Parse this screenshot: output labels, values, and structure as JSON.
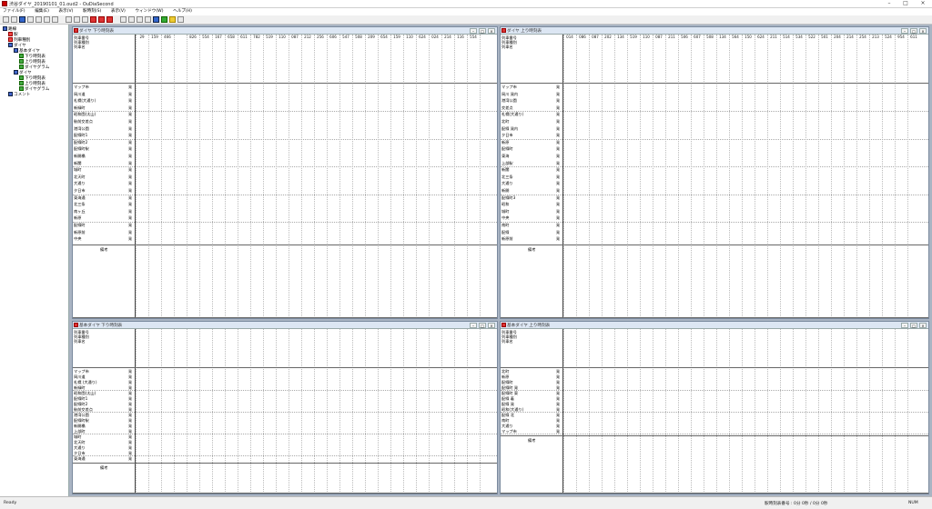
{
  "app": {
    "title": "渋谷ダイヤ_20190101_01.oud2 - OuDiaSecond"
  },
  "menu": [
    "ファイル(F)",
    "編集(E)",
    "表示(V)",
    "駅時刻(S)",
    "表示(V)",
    "ウィンドウ(W)",
    "ヘルプ(H)"
  ],
  "toolbar": {
    "buttons": [
      "new-icon",
      "open-icon",
      "save-icon",
      "print-icon",
      "undo-icon",
      "redo-icon",
      "cut-icon",
      "copy-icon",
      "paste-icon",
      "delete-icon",
      "window-icon",
      "cascade-icon",
      "tile-icon",
      "up-icon",
      "down-icon",
      "left-icon",
      "right-icon",
      "station-icon",
      "train-icon",
      "diagram-icon",
      "help-icon"
    ]
  },
  "tree": {
    "items": [
      {
        "label": "路線",
        "level": 0,
        "icon": "route-icon"
      },
      {
        "label": "駅",
        "level": 1,
        "icon": "station-icon"
      },
      {
        "label": "列車種別",
        "level": 1,
        "icon": "train-type-icon"
      },
      {
        "label": "ダイヤ",
        "level": 1,
        "icon": "dia-icon"
      },
      {
        "label": "基本ダイヤ",
        "level": 2,
        "icon": "dia-icon"
      },
      {
        "label": "下り時刻表",
        "level": 3,
        "icon": "timetable-icon"
      },
      {
        "label": "上り時刻表",
        "level": 3,
        "icon": "timetable-icon"
      },
      {
        "label": "ダイヤグラム",
        "level": 3,
        "icon": "diagram-icon"
      },
      {
        "label": "ダイヤ",
        "level": 2,
        "icon": "dia-icon"
      },
      {
        "label": "下り時刻表",
        "level": 3,
        "icon": "timetable-icon"
      },
      {
        "label": "上り時刻表",
        "level": 3,
        "icon": "timetable-icon"
      },
      {
        "label": "ダイヤグラム",
        "level": 3,
        "icon": "diagram-icon"
      },
      {
        "label": "コメント",
        "level": 1,
        "icon": "comment-icon"
      }
    ]
  },
  "windows": [
    {
      "title": "ダイヤ 下り時刻表",
      "row_labels": [
        "列車番号",
        "列車種別",
        "列車名"
      ],
      "remarks_label": "備考",
      "columns": [
        "29",
        "159",
        "466",
        "",
        "826",
        "554",
        "167",
        "658",
        "611",
        "782",
        "519",
        "110",
        "087",
        "212",
        "256",
        "606",
        "547",
        "508",
        "209",
        "654",
        "159",
        "110",
        "624",
        "024",
        "214",
        "116",
        "554"
      ],
      "stations": [
        "マップ市",
        "岡川道",
        "札幌(大通り)",
        "新緑町",
        "昭和園(太山)",
        "駅前交差点",
        "港湾公園",
        "配線町1",
        "配線町2",
        "配線町駅",
        "新開橋",
        "新聞",
        "城町",
        "北天町",
        "大通り",
        "夕日市",
        "東海通",
        "北三条",
        "南ヶ丘",
        "新原",
        "配線町",
        "新原前",
        "中央"
      ],
      "badge_col": "発"
    },
    {
      "title": "ダイヤ 上り時刻表",
      "row_labels": [
        "列車番号",
        "列車種別",
        "列車名"
      ],
      "remarks_label": "備考",
      "columns": [
        "014",
        "086",
        "087",
        "202",
        "134",
        "519",
        "110",
        "087",
        "211",
        "506",
        "607",
        "508",
        "134",
        "564",
        "150",
        "624",
        "211",
        "514",
        "534",
        "522",
        "501",
        "204",
        "214",
        "254",
        "213",
        "524",
        "954",
        "611",
        "110"
      ],
      "stations": [
        "マップ市",
        "岡川 発内",
        "港湾公園",
        "交差点",
        "札幌(大通り)",
        "北町",
        "配線 発内",
        "夕日市",
        "新原",
        "配線町",
        "東海",
        "上部駅",
        "新聞",
        "北三条",
        "大通り",
        "新開",
        "配線町3",
        "昭和",
        "城町",
        "中央",
        "南町",
        "配線",
        "新原前"
      ],
      "badge_col": "発"
    },
    {
      "title": "基本ダイヤ 下り時刻表",
      "row_labels": [
        "列車番号",
        "列車種別",
        "列車名"
      ],
      "remarks_label": "備考",
      "stations": [
        "マップ市",
        "岡川道",
        "札幌 (大通り)",
        "新緑町",
        "昭和園(太山)",
        "配線町1",
        "配線町2",
        "駅前交差点",
        "港湾公園",
        "配線町駅",
        "新開橋",
        "上部町",
        "城町",
        "北天町",
        "大通り",
        "夕日市",
        "東海通"
      ],
      "badge_col": "発"
    },
    {
      "title": "基本ダイヤ 上り時刻表",
      "row_labels": [
        "列車番号",
        "列車種別",
        "列車名"
      ],
      "remarks_label": "備考",
      "stations": [
        "北町",
        "新原",
        "配線町",
        "配線町 発",
        "配線町 東",
        "配線 着",
        "配線 発",
        "昭和(大通り)",
        "配線 北",
        "南町",
        "大通り",
        "マップ市"
      ],
      "badge_col": "発"
    }
  ],
  "status": {
    "left": "Ready",
    "middle": "駅時刻表番号 : 0分 0秒 / 0分 0秒",
    "right": "NUM"
  }
}
